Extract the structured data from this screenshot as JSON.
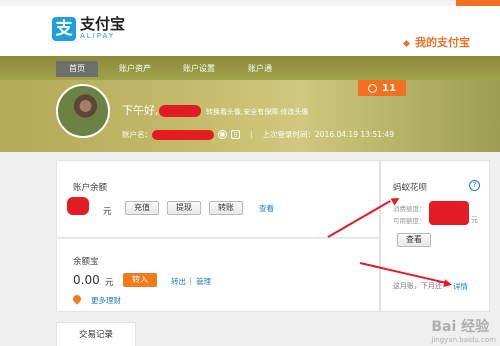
{
  "brand": {
    "logo_char": "支",
    "name_cn": "支付宝",
    "name_en": "ALIPAY",
    "my_alipay": "我的支付宝"
  },
  "nav": {
    "tabs": [
      {
        "label": "首页",
        "active": true
      },
      {
        "label": "账户资产",
        "active": false
      },
      {
        "label": "账户设置",
        "active": false
      },
      {
        "label": "账户通",
        "active": false
      }
    ]
  },
  "banner": {
    "greeting_prefix": "下午好,",
    "avatar_hint": "转换看头像,安全有保障 修改头像",
    "account_label": "账户名：",
    "last_login": "上次登录时间：2016.04.19 13:51:49",
    "message_count": "11"
  },
  "balance": {
    "title": "账户余额",
    "currency": "元",
    "recharge": "充值",
    "withdraw": "提现",
    "transfer": "转账",
    "view": "查看"
  },
  "yuebao": {
    "title": "余额宝",
    "amount": "0.00",
    "currency": "元",
    "transfer_in": "转入",
    "transfer_out": "转出",
    "manage": "管理",
    "more": "更多理财"
  },
  "huabei": {
    "title": "蚂蚁花呗",
    "help": "?",
    "consumed_label": "消费额度：",
    "available_label": "可用额度：",
    "currency": "元",
    "view_button": "查看",
    "bill_note": "这月账，下月还",
    "details": "详情"
  },
  "bottom_tabs": {
    "transactions": "交易记录"
  },
  "watermark": {
    "main": "Bai 经验",
    "sub": "jingyan.baidu.com"
  },
  "colors": {
    "brand_blue": "#1e9fdc",
    "accent_orange": "#f36f21",
    "redaction_red": "#e31b23"
  }
}
